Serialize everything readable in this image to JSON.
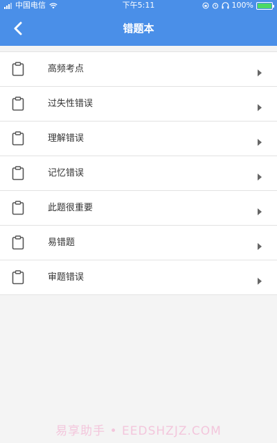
{
  "status_bar": {
    "carrier": "中国电信",
    "time": "下午5:11",
    "battery": "100%"
  },
  "nav": {
    "title": "错题本",
    "back_icon": "chevron-left-icon"
  },
  "list": {
    "item_icon": "clipboard-icon",
    "chevron_icon": "chevron-right-icon",
    "items": [
      {
        "label": "高频考点"
      },
      {
        "label": "过失性错误"
      },
      {
        "label": "理解错误"
      },
      {
        "label": "记忆错误"
      },
      {
        "label": "此题很重要"
      },
      {
        "label": "易错题"
      },
      {
        "label": "审题错误"
      }
    ]
  },
  "watermark": "易享助手 • EEDSHZJZ.COM",
  "colors": {
    "accent": "#4a8fe8",
    "background": "#f4f4f4",
    "text": "#333333",
    "battery_fill": "#4cd964"
  }
}
